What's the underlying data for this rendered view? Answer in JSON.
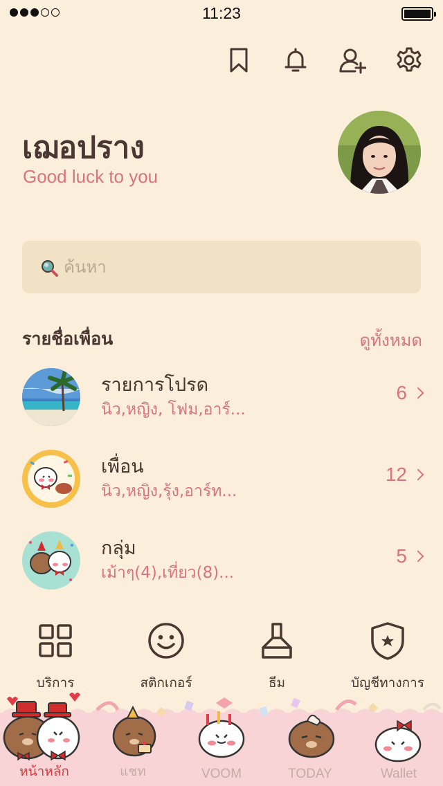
{
  "status_bar": {
    "time": "11:23"
  },
  "top_icons": [
    "bookmark-icon",
    "bell-icon",
    "add-friend-icon",
    "settings-icon"
  ],
  "profile": {
    "name": "เฌอปราง",
    "status_message": "Good luck to you"
  },
  "search": {
    "placeholder": "ค้นหา"
  },
  "friends_section": {
    "title": "รายชื่อเพื่อน",
    "see_all": "ดูทั้งหมด"
  },
  "lists": [
    {
      "title": "รายการโปรด",
      "subtitle": "นิว,หญิง, โฟม,อาร์...",
      "count": "6"
    },
    {
      "title": "เพื่อน",
      "subtitle": "นิว,หญิง,รุ้ง,อาร์ท...",
      "count": "12"
    },
    {
      "title": "กลุ่ม",
      "subtitle": "เม้าๆ(4),เที่ยว(8)...",
      "count": "5"
    }
  ],
  "features": [
    {
      "label": "บริการ",
      "icon": "services-grid-icon"
    },
    {
      "label": "สติกเกอร์",
      "icon": "sticker-smile-icon"
    },
    {
      "label": "ธีม",
      "icon": "theme-brush-icon"
    },
    {
      "label": "บัญชีทางการ",
      "icon": "official-account-shield-icon"
    }
  ],
  "tabs": [
    {
      "label": "หน้าหลัก",
      "active": true
    },
    {
      "label": "แชท",
      "active": false
    },
    {
      "label": "VOOM",
      "active": false
    },
    {
      "label": "TODAY",
      "active": false
    },
    {
      "label": "Wallet",
      "active": false
    }
  ],
  "colors": {
    "background": "#fbeedb",
    "accent": "#d9747f",
    "text": "#4a3731",
    "tab_bar": "#f8d4d6",
    "active_tab": "#d23b3b"
  }
}
